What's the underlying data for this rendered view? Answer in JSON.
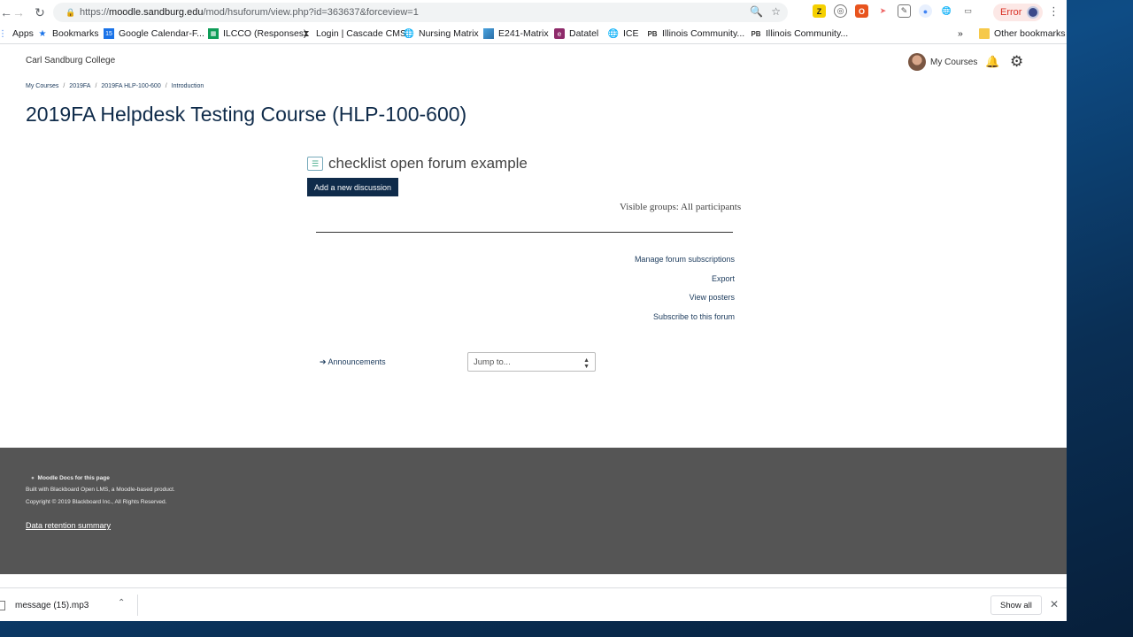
{
  "browser": {
    "url_prefix": "https://",
    "url_host": "moodle.sandburg.edu",
    "url_path": "/mod/hsuforum/view.php?id=363637&forceview=1",
    "error_label": "Error"
  },
  "bookmarks": [
    {
      "label": "Apps"
    },
    {
      "label": "Bookmarks"
    },
    {
      "label": "Google Calendar-F..."
    },
    {
      "label": "ILCCO (Responses)"
    },
    {
      "label": "Login | Cascade CMS"
    },
    {
      "label": "Nursing Matrix"
    },
    {
      "label": "E241-Matrix"
    },
    {
      "label": "Datatel"
    },
    {
      "label": "ICE"
    },
    {
      "label": "Illinois Community..."
    },
    {
      "label": "Illinois Community..."
    },
    {
      "label": "Other bookmarks"
    }
  ],
  "header": {
    "site_name": "Carl Sandburg College",
    "my_courses": "My Courses"
  },
  "breadcrumb": [
    "My Courses",
    "2019FA",
    "2019FA HLP-100-600",
    "Introduction"
  ],
  "course_title": "2019FA Helpdesk Testing Course (HLP-100-600)",
  "forum": {
    "title": "checklist open forum example",
    "add_button": "Add a new discussion",
    "visible_groups": "Visible groups: All participants",
    "links": [
      "Manage forum subscriptions",
      "Export",
      "View posters",
      "Subscribe to this forum"
    ],
    "prev_activity": "➔ Announcements",
    "jump_placeholder": "Jump to..."
  },
  "footer": {
    "docs": "Moodle Docs for this page",
    "built": "Built with Blackboard Open LMS, a Moodle-based product.",
    "copyright": "Copyright © 2019 Blackboard Inc., All Rights Reserved.",
    "data_retention": "Data retention summary"
  },
  "downloads": {
    "file": "message (15).mp3",
    "show_all": "Show all"
  }
}
